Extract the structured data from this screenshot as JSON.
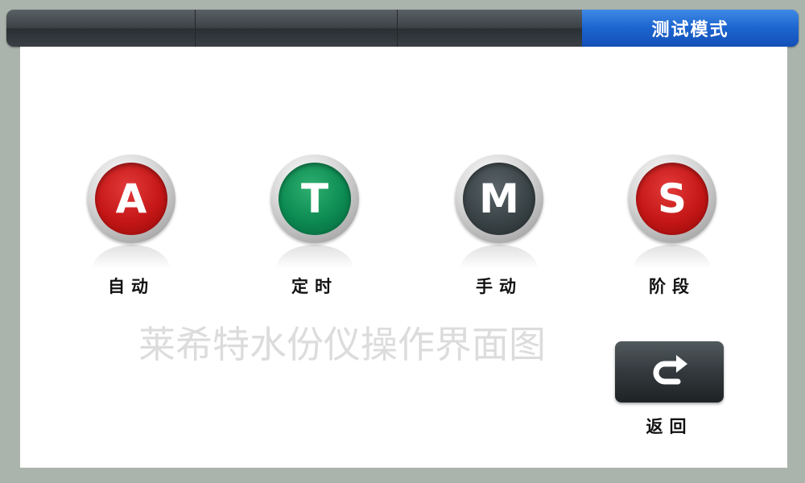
{
  "tabs": [
    {
      "label": ""
    },
    {
      "label": ""
    },
    {
      "label": ""
    },
    {
      "label": "测试模式",
      "active": true
    }
  ],
  "modes": [
    {
      "letter": "A",
      "label": "自动",
      "color": "#c41616"
    },
    {
      "letter": "T",
      "label": "定时",
      "color": "#0c8a52"
    },
    {
      "letter": "M",
      "label": "手动",
      "color": "#3a4346"
    },
    {
      "letter": "S",
      "label": "阶段",
      "color": "#c41616"
    }
  ],
  "watermark": "莱希特水份仪操作界面图",
  "back": {
    "label": "返回",
    "icon": "return-arrow-icon"
  },
  "colors": {
    "active_tab": "#1c64cf",
    "panel": "#ffffff",
    "frame": "#aab4ad"
  }
}
